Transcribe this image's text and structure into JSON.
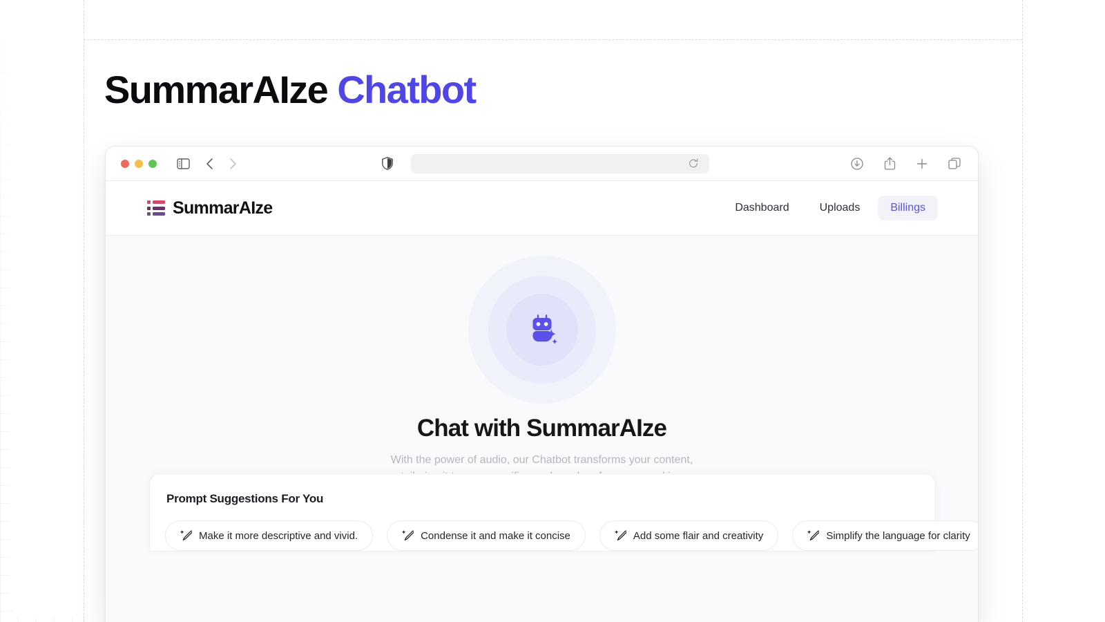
{
  "hero": {
    "title_main": "SummarAIze",
    "title_accent": "Chatbot",
    "accent_color": "#4f46e5"
  },
  "browser": {
    "traffic_lights": [
      "close",
      "minimize",
      "zoom"
    ],
    "icons": {
      "sidebar": "sidebar-icon",
      "back": "chevron-left-icon",
      "forward": "chevron-right-icon",
      "shield": "shield-icon",
      "reload": "reload-icon",
      "download": "download-icon",
      "share": "share-icon",
      "new_tab": "plus-icon",
      "tab_overview": "tab-overview-icon"
    },
    "address_value": "",
    "address_placeholder": ""
  },
  "appbar": {
    "brand_name": "SummarAIze",
    "brand_colors": [
      "#d24a6b",
      "#6b2e73",
      "#6f4a8e"
    ],
    "nav": [
      {
        "label": "Dashboard",
        "active": false
      },
      {
        "label": "Uploads",
        "active": false
      },
      {
        "label": "Billings",
        "active": true
      }
    ],
    "active_color": "#5b53e0"
  },
  "canvas": {
    "robot_icon": "robot-sparkle-icon",
    "robot_color": "#5b51e8",
    "title": "Chat with SummarAIze",
    "subtitle": "With the power of audio, our Chatbot transforms your content, tailoring it to your specific needs and preferences, making customization a breeze."
  },
  "suggestions": {
    "title": "Prompt Suggestions For You",
    "chips": [
      {
        "icon": "magic-wand-icon",
        "label": "Make it more descriptive and vivid."
      },
      {
        "icon": "magic-wand-icon",
        "label": "Condense it and make it concise"
      },
      {
        "icon": "magic-wand-icon",
        "label": "Add some flair and creativity"
      },
      {
        "icon": "magic-wand-icon",
        "label": "Simplify the language for clarity"
      }
    ]
  }
}
